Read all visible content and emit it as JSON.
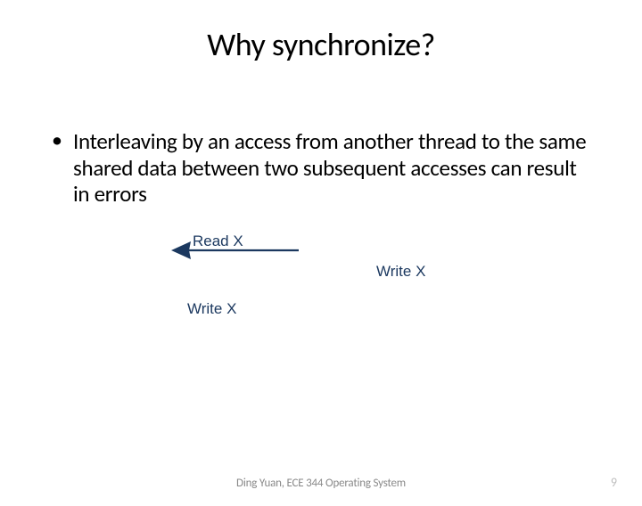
{
  "title": "Why synchronize?",
  "bullets": [
    "Interleaving by an access from another thread to the same shared data between two subsequent accesses can result in errors"
  ],
  "diagram": {
    "read_x": "Read   X",
    "write_x_right": "Write X",
    "write_x_left": "Write X"
  },
  "footer": "Ding Yuan, ECE 344 Operating System",
  "page_number": "9"
}
